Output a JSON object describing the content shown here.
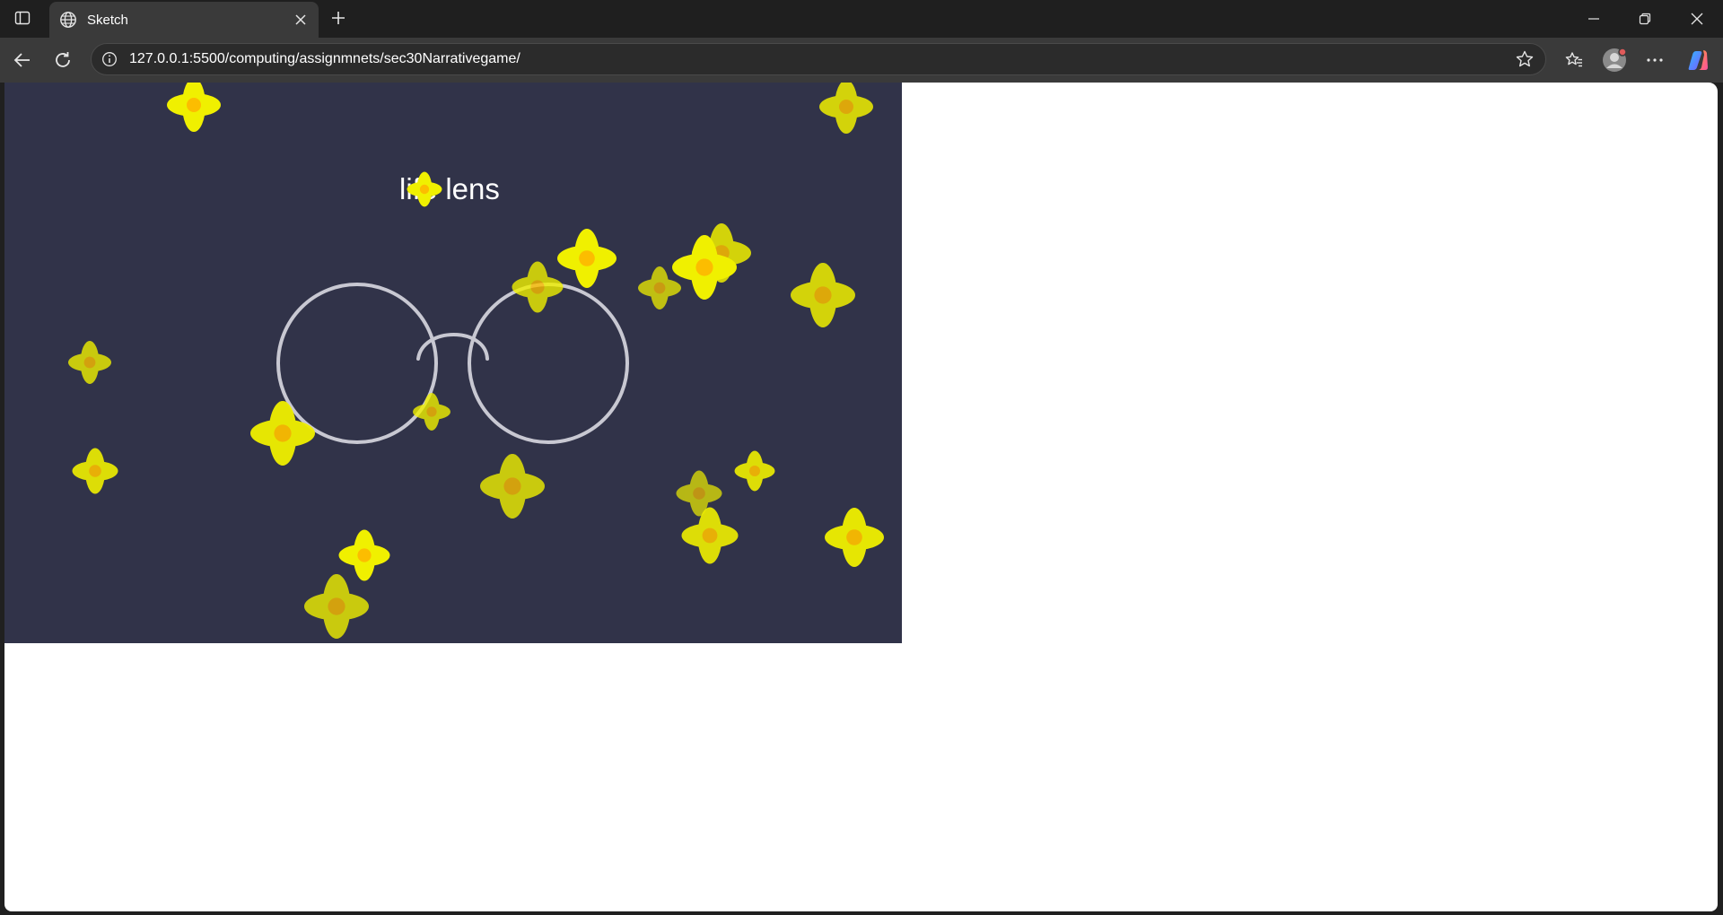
{
  "browser": {
    "tab": {
      "title": "Sketch",
      "favicon": "globe-icon"
    },
    "address": {
      "url": "127.0.0.1:5500/computing/assignmnets/sec30Narrativegame/"
    },
    "icons": {
      "tab_actions": "tab-actions-icon",
      "close_tab": "close-icon",
      "new_tab": "plus-icon",
      "back": "back-arrow-icon",
      "refresh": "refresh-icon",
      "info": "info-icon",
      "favorite": "star-icon",
      "favorites": "favorites-icon",
      "profile": "profile-icon",
      "more": "more-icon",
      "copilot": "copilot-icon"
    }
  },
  "game": {
    "title": "life lens",
    "colors": {
      "background": "#313349",
      "flower": "#f0f000",
      "flower_center": "#ffb000",
      "glasses": "#c8c8d2"
    }
  }
}
